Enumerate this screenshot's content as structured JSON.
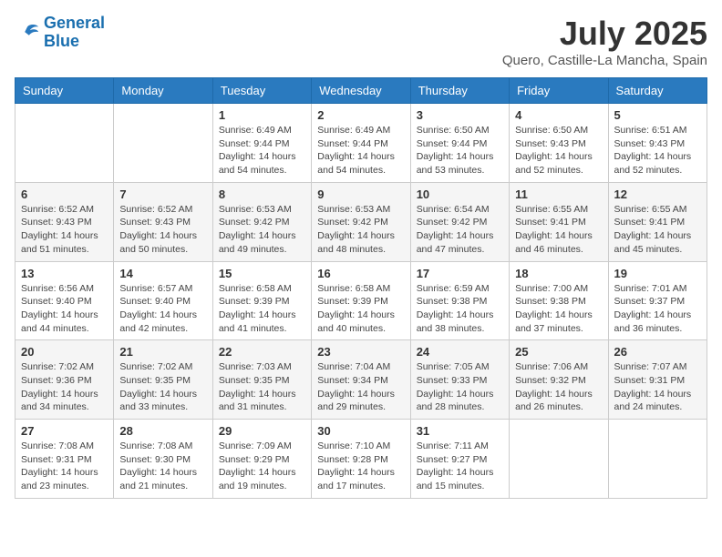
{
  "logo": {
    "line1": "General",
    "line2": "Blue"
  },
  "title": "July 2025",
  "location": "Quero, Castille-La Mancha, Spain",
  "days_of_week": [
    "Sunday",
    "Monday",
    "Tuesday",
    "Wednesday",
    "Thursday",
    "Friday",
    "Saturday"
  ],
  "weeks": [
    [
      {
        "day": "",
        "info": ""
      },
      {
        "day": "",
        "info": ""
      },
      {
        "day": "1",
        "info": "Sunrise: 6:49 AM\nSunset: 9:44 PM\nDaylight: 14 hours and 54 minutes."
      },
      {
        "day": "2",
        "info": "Sunrise: 6:49 AM\nSunset: 9:44 PM\nDaylight: 14 hours and 54 minutes."
      },
      {
        "day": "3",
        "info": "Sunrise: 6:50 AM\nSunset: 9:44 PM\nDaylight: 14 hours and 53 minutes."
      },
      {
        "day": "4",
        "info": "Sunrise: 6:50 AM\nSunset: 9:43 PM\nDaylight: 14 hours and 52 minutes."
      },
      {
        "day": "5",
        "info": "Sunrise: 6:51 AM\nSunset: 9:43 PM\nDaylight: 14 hours and 52 minutes."
      }
    ],
    [
      {
        "day": "6",
        "info": "Sunrise: 6:52 AM\nSunset: 9:43 PM\nDaylight: 14 hours and 51 minutes."
      },
      {
        "day": "7",
        "info": "Sunrise: 6:52 AM\nSunset: 9:43 PM\nDaylight: 14 hours and 50 minutes."
      },
      {
        "day": "8",
        "info": "Sunrise: 6:53 AM\nSunset: 9:42 PM\nDaylight: 14 hours and 49 minutes."
      },
      {
        "day": "9",
        "info": "Sunrise: 6:53 AM\nSunset: 9:42 PM\nDaylight: 14 hours and 48 minutes."
      },
      {
        "day": "10",
        "info": "Sunrise: 6:54 AM\nSunset: 9:42 PM\nDaylight: 14 hours and 47 minutes."
      },
      {
        "day": "11",
        "info": "Sunrise: 6:55 AM\nSunset: 9:41 PM\nDaylight: 14 hours and 46 minutes."
      },
      {
        "day": "12",
        "info": "Sunrise: 6:55 AM\nSunset: 9:41 PM\nDaylight: 14 hours and 45 minutes."
      }
    ],
    [
      {
        "day": "13",
        "info": "Sunrise: 6:56 AM\nSunset: 9:40 PM\nDaylight: 14 hours and 44 minutes."
      },
      {
        "day": "14",
        "info": "Sunrise: 6:57 AM\nSunset: 9:40 PM\nDaylight: 14 hours and 42 minutes."
      },
      {
        "day": "15",
        "info": "Sunrise: 6:58 AM\nSunset: 9:39 PM\nDaylight: 14 hours and 41 minutes."
      },
      {
        "day": "16",
        "info": "Sunrise: 6:58 AM\nSunset: 9:39 PM\nDaylight: 14 hours and 40 minutes."
      },
      {
        "day": "17",
        "info": "Sunrise: 6:59 AM\nSunset: 9:38 PM\nDaylight: 14 hours and 38 minutes."
      },
      {
        "day": "18",
        "info": "Sunrise: 7:00 AM\nSunset: 9:38 PM\nDaylight: 14 hours and 37 minutes."
      },
      {
        "day": "19",
        "info": "Sunrise: 7:01 AM\nSunset: 9:37 PM\nDaylight: 14 hours and 36 minutes."
      }
    ],
    [
      {
        "day": "20",
        "info": "Sunrise: 7:02 AM\nSunset: 9:36 PM\nDaylight: 14 hours and 34 minutes."
      },
      {
        "day": "21",
        "info": "Sunrise: 7:02 AM\nSunset: 9:35 PM\nDaylight: 14 hours and 33 minutes."
      },
      {
        "day": "22",
        "info": "Sunrise: 7:03 AM\nSunset: 9:35 PM\nDaylight: 14 hours and 31 minutes."
      },
      {
        "day": "23",
        "info": "Sunrise: 7:04 AM\nSunset: 9:34 PM\nDaylight: 14 hours and 29 minutes."
      },
      {
        "day": "24",
        "info": "Sunrise: 7:05 AM\nSunset: 9:33 PM\nDaylight: 14 hours and 28 minutes."
      },
      {
        "day": "25",
        "info": "Sunrise: 7:06 AM\nSunset: 9:32 PM\nDaylight: 14 hours and 26 minutes."
      },
      {
        "day": "26",
        "info": "Sunrise: 7:07 AM\nSunset: 9:31 PM\nDaylight: 14 hours and 24 minutes."
      }
    ],
    [
      {
        "day": "27",
        "info": "Sunrise: 7:08 AM\nSunset: 9:31 PM\nDaylight: 14 hours and 23 minutes."
      },
      {
        "day": "28",
        "info": "Sunrise: 7:08 AM\nSunset: 9:30 PM\nDaylight: 14 hours and 21 minutes."
      },
      {
        "day": "29",
        "info": "Sunrise: 7:09 AM\nSunset: 9:29 PM\nDaylight: 14 hours and 19 minutes."
      },
      {
        "day": "30",
        "info": "Sunrise: 7:10 AM\nSunset: 9:28 PM\nDaylight: 14 hours and 17 minutes."
      },
      {
        "day": "31",
        "info": "Sunrise: 7:11 AM\nSunset: 9:27 PM\nDaylight: 14 hours and 15 minutes."
      },
      {
        "day": "",
        "info": ""
      },
      {
        "day": "",
        "info": ""
      }
    ]
  ]
}
